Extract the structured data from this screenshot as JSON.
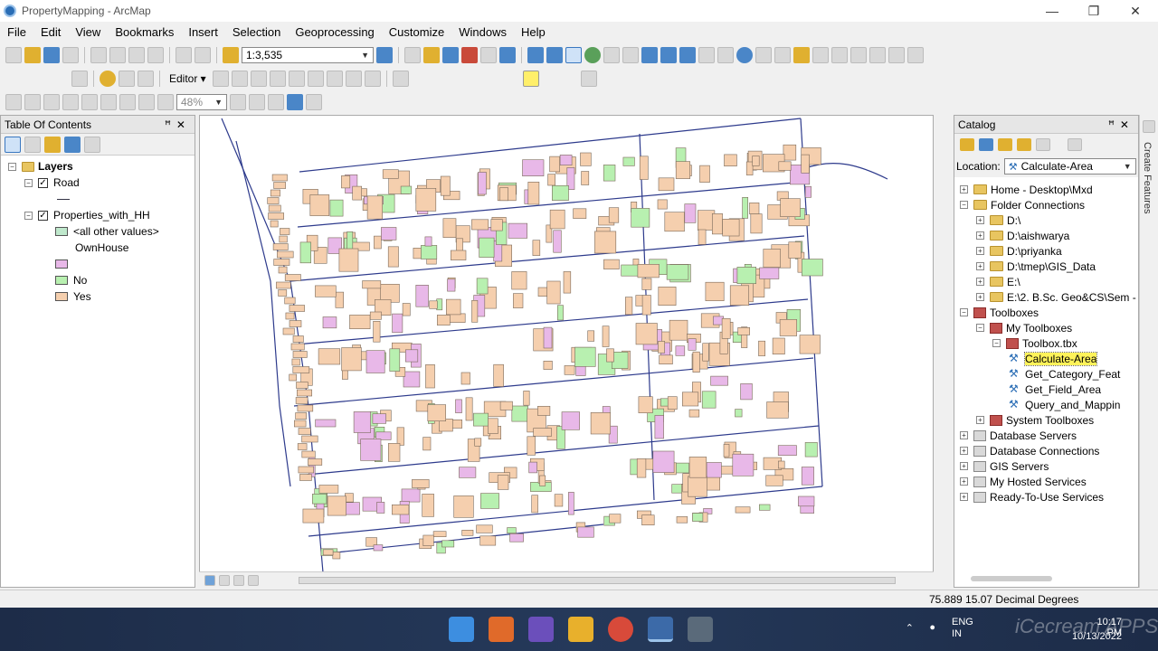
{
  "window": {
    "title": "PropertyMapping - ArcMap",
    "minimize": "—",
    "maximize": "❐",
    "close": "✕"
  },
  "menu": [
    "File",
    "Edit",
    "View",
    "Bookmarks",
    "Insert",
    "Selection",
    "Geoprocessing",
    "Customize",
    "Windows",
    "Help"
  ],
  "toolbar": {
    "scale": "1:3,535",
    "editor_label": "Editor ▾",
    "zoom": "48%"
  },
  "toc": {
    "title": "Table Of Contents",
    "root": "Layers",
    "layers": [
      {
        "name": "Road"
      },
      {
        "name": "Properties_with_HH",
        "field": "OwnHouse",
        "classes": [
          {
            "label": "<all other values>",
            "color": "#bfe8cc"
          },
          {
            "label": "",
            "color": "#e8b8e8"
          },
          {
            "label": "No",
            "color": "#b8f0b0"
          },
          {
            "label": "Yes",
            "color": "#f5cfae"
          }
        ]
      }
    ]
  },
  "catalog": {
    "title": "Catalog",
    "location_label": "Location:",
    "location_value": "Calculate-Area",
    "tree": [
      {
        "label": "Home - Desktop\\Mxd",
        "icon": "folder-home",
        "indent": 0,
        "expander": "+"
      },
      {
        "label": "Folder Connections",
        "icon": "folder",
        "indent": 0,
        "expander": "−"
      },
      {
        "label": "D:\\",
        "icon": "folder",
        "indent": 1,
        "expander": "+"
      },
      {
        "label": "D:\\aishwarya",
        "icon": "folder",
        "indent": 1,
        "expander": "+"
      },
      {
        "label": "D:\\priyanka",
        "icon": "folder",
        "indent": 1,
        "expander": "+"
      },
      {
        "label": "D:\\tmep\\GIS_Data",
        "icon": "folder",
        "indent": 1,
        "expander": "+"
      },
      {
        "label": "E:\\",
        "icon": "folder",
        "indent": 1,
        "expander": "+"
      },
      {
        "label": "E:\\2. B.Sc. Geo&CS\\Sem -",
        "icon": "folder",
        "indent": 1,
        "expander": "+"
      },
      {
        "label": "Toolboxes",
        "icon": "toolbox",
        "indent": 0,
        "expander": "−"
      },
      {
        "label": "My Toolboxes",
        "icon": "toolbox",
        "indent": 1,
        "expander": "−"
      },
      {
        "label": "Toolbox.tbx",
        "icon": "toolbox",
        "indent": 2,
        "expander": "−"
      },
      {
        "label": "Calculate-Area",
        "icon": "tool",
        "indent": 3,
        "expander": "",
        "selected": true
      },
      {
        "label": "Get_Category_Feat",
        "icon": "tool",
        "indent": 3,
        "expander": ""
      },
      {
        "label": "Get_Field_Area",
        "icon": "tool",
        "indent": 3,
        "expander": ""
      },
      {
        "label": "Query_and_Mappin",
        "icon": "tool",
        "indent": 3,
        "expander": ""
      },
      {
        "label": "System Toolboxes",
        "icon": "toolbox",
        "indent": 1,
        "expander": "+"
      },
      {
        "label": "Database Servers",
        "icon": "server",
        "indent": 0,
        "expander": "+"
      },
      {
        "label": "Database Connections",
        "icon": "server",
        "indent": 0,
        "expander": "+"
      },
      {
        "label": "GIS Servers",
        "icon": "server",
        "indent": 0,
        "expander": "+"
      },
      {
        "label": "My Hosted Services",
        "icon": "server",
        "indent": 0,
        "expander": "+"
      },
      {
        "label": "Ready-To-Use Services",
        "icon": "server",
        "indent": 0,
        "expander": "+"
      }
    ]
  },
  "sidebar_tab": "Create Features",
  "status": {
    "coords": "75.889  15.07 Decimal Degrees"
  },
  "taskbar": {
    "lang": "ENG\nIN",
    "time": "10:17 PM",
    "date": "10/13/2022"
  },
  "watermark": "iCecream APPS"
}
